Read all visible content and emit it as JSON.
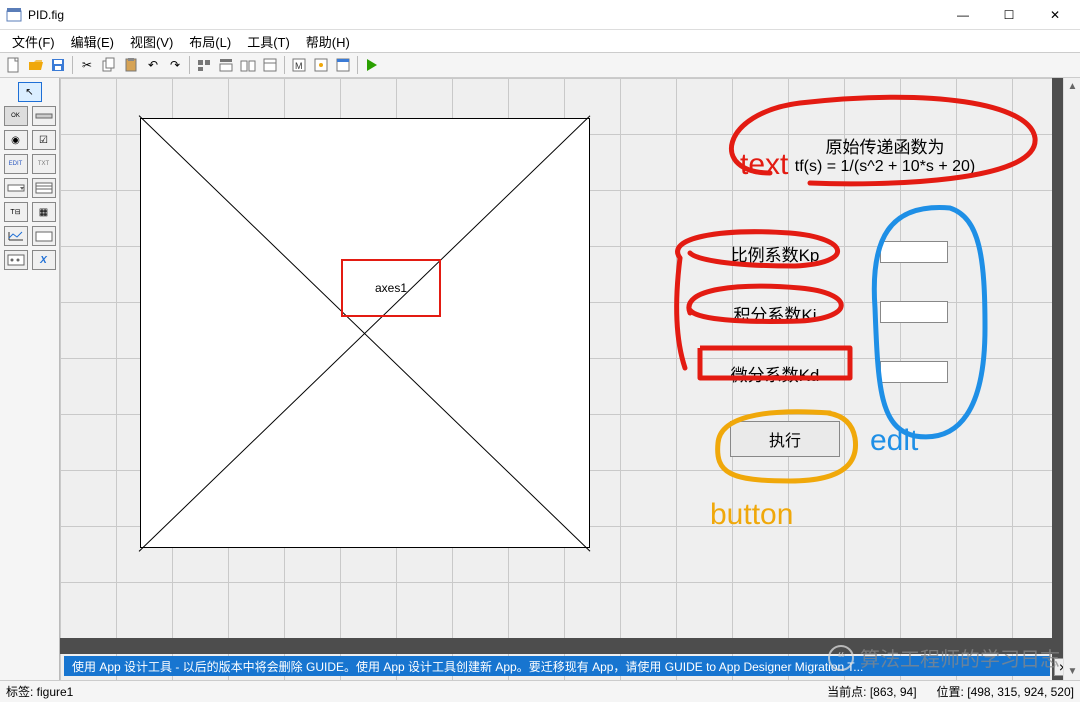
{
  "window": {
    "title": "PID.fig"
  },
  "menubar": {
    "file": "文件(F)",
    "edit": "编辑(E)",
    "view": "视图(V)",
    "layout": "布局(L)",
    "tools": "工具(T)",
    "help": "帮助(H)"
  },
  "palette": {
    "arrow": "↖",
    "pushbutton_icon": "OK",
    "slider_icon": "SLDR",
    "radio_icon": "◯",
    "checkbox_icon": "☑",
    "edit_icon": "EDIT",
    "static_icon": "TXT",
    "popup_icon": "▭",
    "listbox_icon": "▤",
    "toggle_icon": "T⊟",
    "table_icon": "▦",
    "axes_icon": "📈",
    "panel_icon": "▭",
    "buttongroup_icon": "⊞",
    "activex_icon": "X"
  },
  "canvas": {
    "axes_label": "axes1",
    "tf_title": "原始传递函数为",
    "tf_expr": "tf(s) = 1/(s^2 + 10*s + 20)",
    "label_kp": "比例系数Kp",
    "label_ki": "积分系数Ki",
    "label_kd": "微分系数Kd",
    "exec_button": "执行"
  },
  "annot": {
    "text": "text",
    "edit": "edit",
    "button": "button"
  },
  "banner": {
    "text": "使用 App 设计工具 - 以后的版本中将会删除 GUIDE。使用 App 设计工具创建新 App。要迁移现有 App，请使用 GUIDE to App Designer Migration T..."
  },
  "statusbar": {
    "tag": "标签: figure1",
    "current_point_label": "当前点:",
    "current_point": "[863, 94]",
    "position_label": "位置:",
    "position": "[498, 315, 924, 520]"
  },
  "watermark": {
    "text": "算法工程师的学习日志"
  }
}
